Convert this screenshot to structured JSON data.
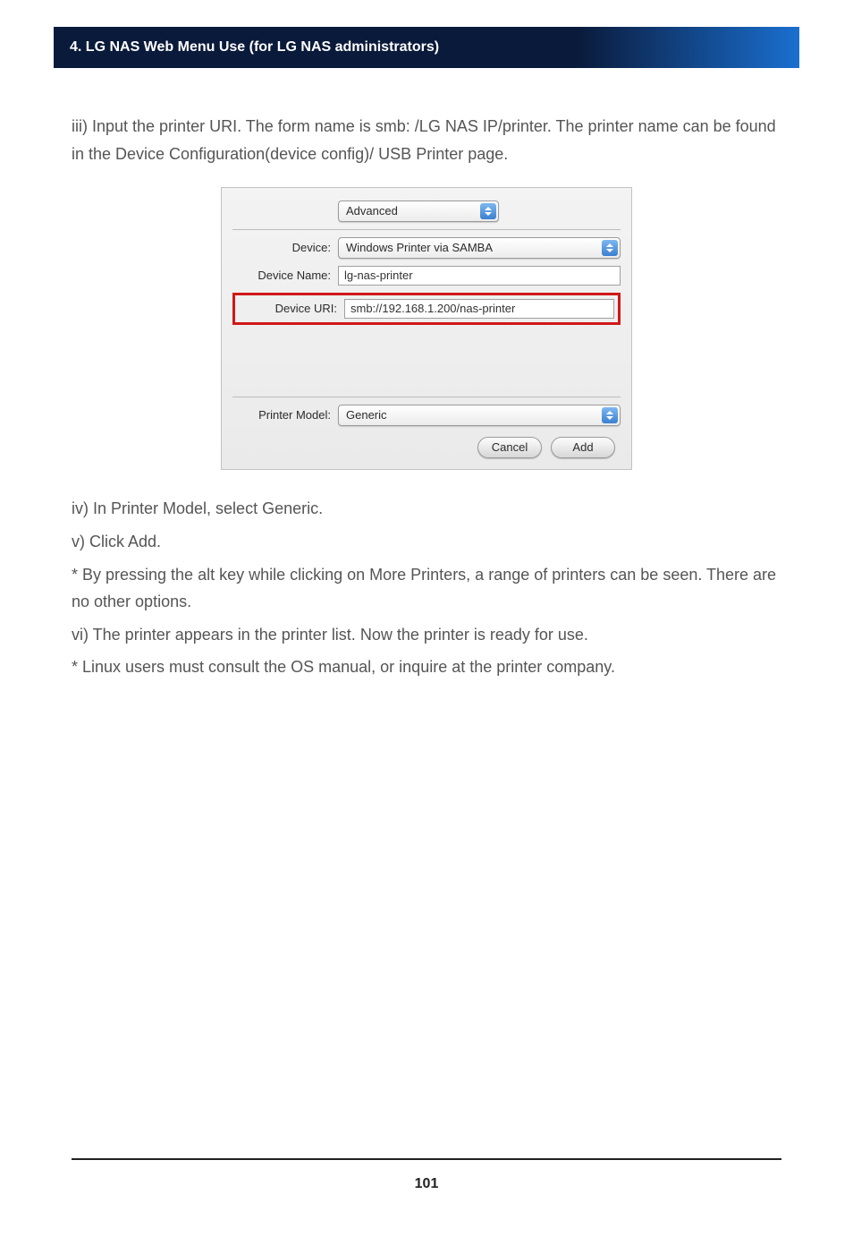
{
  "header": {
    "title": "4. LG NAS Web Menu Use (for LG NAS administrators)"
  },
  "body": {
    "p_iii": "iii) Input the printer URI. The form name is smb: /LG NAS IP/printer. The printer name can be found in the Device Configuration(device config)/ USB Printer page.",
    "p_iv": "iv) In Printer Model, select Generic.",
    "p_v": "v)  Click Add.",
    "p_note1": "* By pressing the alt key while clicking on More Printers, a range of printers can be seen. There are no other options.",
    "p_vi": "vi) The printer appears in the printer list. Now the printer is ready for use.",
    "p_note2": "* Linux users must consult the OS manual, or inquire at the printer company."
  },
  "dialog": {
    "top_select": "Advanced",
    "labels": {
      "device": "Device:",
      "device_name": "Device Name:",
      "device_uri": "Device URI:",
      "printer_model": "Printer Model:"
    },
    "values": {
      "device": "Windows Printer via SAMBA",
      "device_name": "lg-nas-printer",
      "device_uri": "smb://192.168.1.200/nas-printer",
      "printer_model": "Generic"
    },
    "buttons": {
      "cancel": "Cancel",
      "add": "Add"
    }
  },
  "footer": {
    "page_number": "101"
  }
}
